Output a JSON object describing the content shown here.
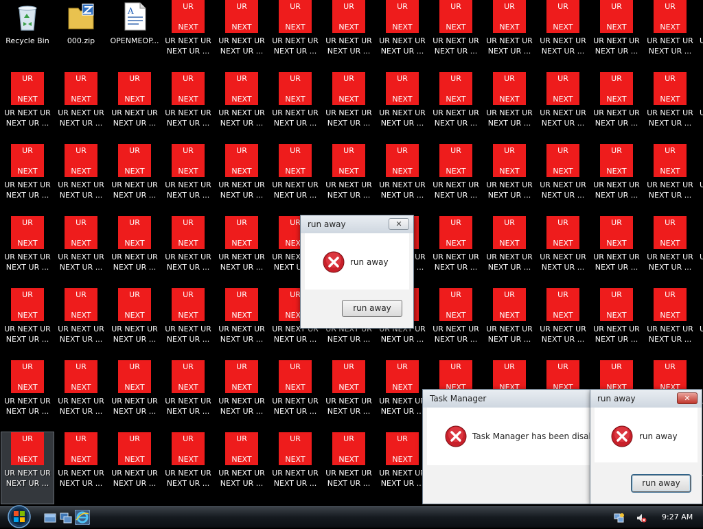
{
  "desktop": {
    "tile_top_text": "UR",
    "tile_bottom_text": "NEXT",
    "ur_label_line1": "UR NEXT UR",
    "ur_label_line2": "NEXT UR ...",
    "system_icons": [
      {
        "label": "Recycle Bin",
        "icon": "recycle-bin-icon"
      },
      {
        "label": "000.zip",
        "icon": "zip-folder-icon"
      },
      {
        "label": "OPENMEOP...",
        "icon": "document-icon"
      }
    ],
    "edge_label_fragment": "U"
  },
  "dialogs": {
    "run_away_1": {
      "title": "run away",
      "message": "run away",
      "button": "run away",
      "close": "✕"
    },
    "task_manager": {
      "title": "Task Manager",
      "message": "Task Manager has been disabled"
    },
    "run_away_2": {
      "title": "run away",
      "message": "run away",
      "button": "run away",
      "close": "✕"
    }
  },
  "taskbar": {
    "clock": "9:27 AM",
    "quick_launch": [
      "show-desktop-icon",
      "switch-windows-icon",
      "internet-explorer-icon"
    ],
    "tray": [
      "network-icon",
      "volume-muted-icon"
    ]
  },
  "colors": {
    "tile_red": "#ee1c1c",
    "desktop_bg": "#000000",
    "error_red": "#c8202a"
  }
}
